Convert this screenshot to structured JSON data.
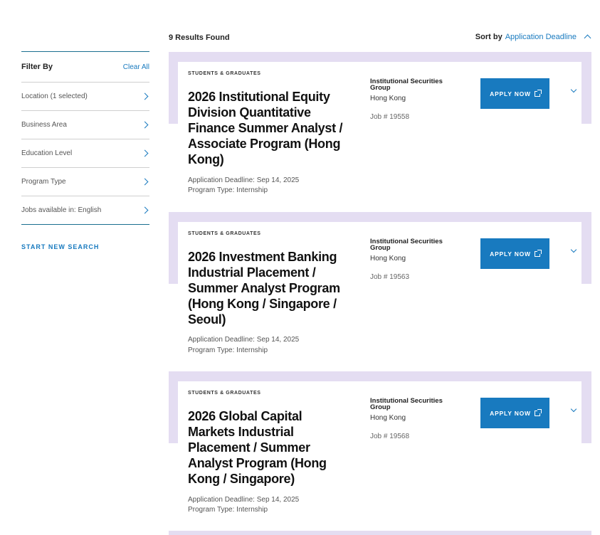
{
  "results": {
    "count_text": "9 Results Found"
  },
  "sort": {
    "label": "Sort by",
    "value": "Application Deadline"
  },
  "sidebar": {
    "title": "Filter By",
    "clear_all": "Clear All",
    "filters": [
      {
        "label": "Location (1 selected)"
      },
      {
        "label": "Business Area"
      },
      {
        "label": "Education Level"
      },
      {
        "label": "Program Type"
      },
      {
        "label": "Jobs available in: English"
      }
    ],
    "start_new_search": "START NEW SEARCH"
  },
  "jobs": [
    {
      "category": "STUDENTS & GRADUATES",
      "title": "2026 Institutional Equity Division Quantitative Finance Summer Analyst / Associate Program (Hong Kong)",
      "deadline": "Application Deadline: Sep 14, 2025",
      "program_type": "Program Type: Internship",
      "group": "Institutional Securities Group",
      "location": "Hong Kong",
      "job_id": "Job # 19558",
      "apply_label": "APPLY NOW"
    },
    {
      "category": "STUDENTS & GRADUATES",
      "title": "2026 Investment Banking Industrial Placement / Summer Analyst Program (Hong Kong / Singapore / Seoul)",
      "deadline": "Application Deadline: Sep 14, 2025",
      "program_type": "Program Type: Internship",
      "group": "Institutional Securities Group",
      "location": "Hong Kong",
      "job_id": "Job # 19563",
      "apply_label": "APPLY NOW"
    },
    {
      "category": "STUDENTS & GRADUATES",
      "title": "2026 Global Capital Markets Industrial Placement / Summer Analyst Program (Hong Kong / Singapore)",
      "deadline": "Application Deadline: Sep 14, 2025",
      "program_type": "Program Type: Internship",
      "group": "Institutional Securities Group",
      "location": "Hong Kong",
      "job_id": "Job # 19568",
      "apply_label": "APPLY NOW"
    }
  ],
  "colors": {
    "accent": "#187abf",
    "card_band": "#e4ddf2",
    "rule": "#1a6f8f"
  },
  "icons": {
    "filter_row": "chevron-right-icon",
    "sort": "chevron-up-icon",
    "expand": "chevron-down-icon",
    "apply": "external-link-icon"
  }
}
